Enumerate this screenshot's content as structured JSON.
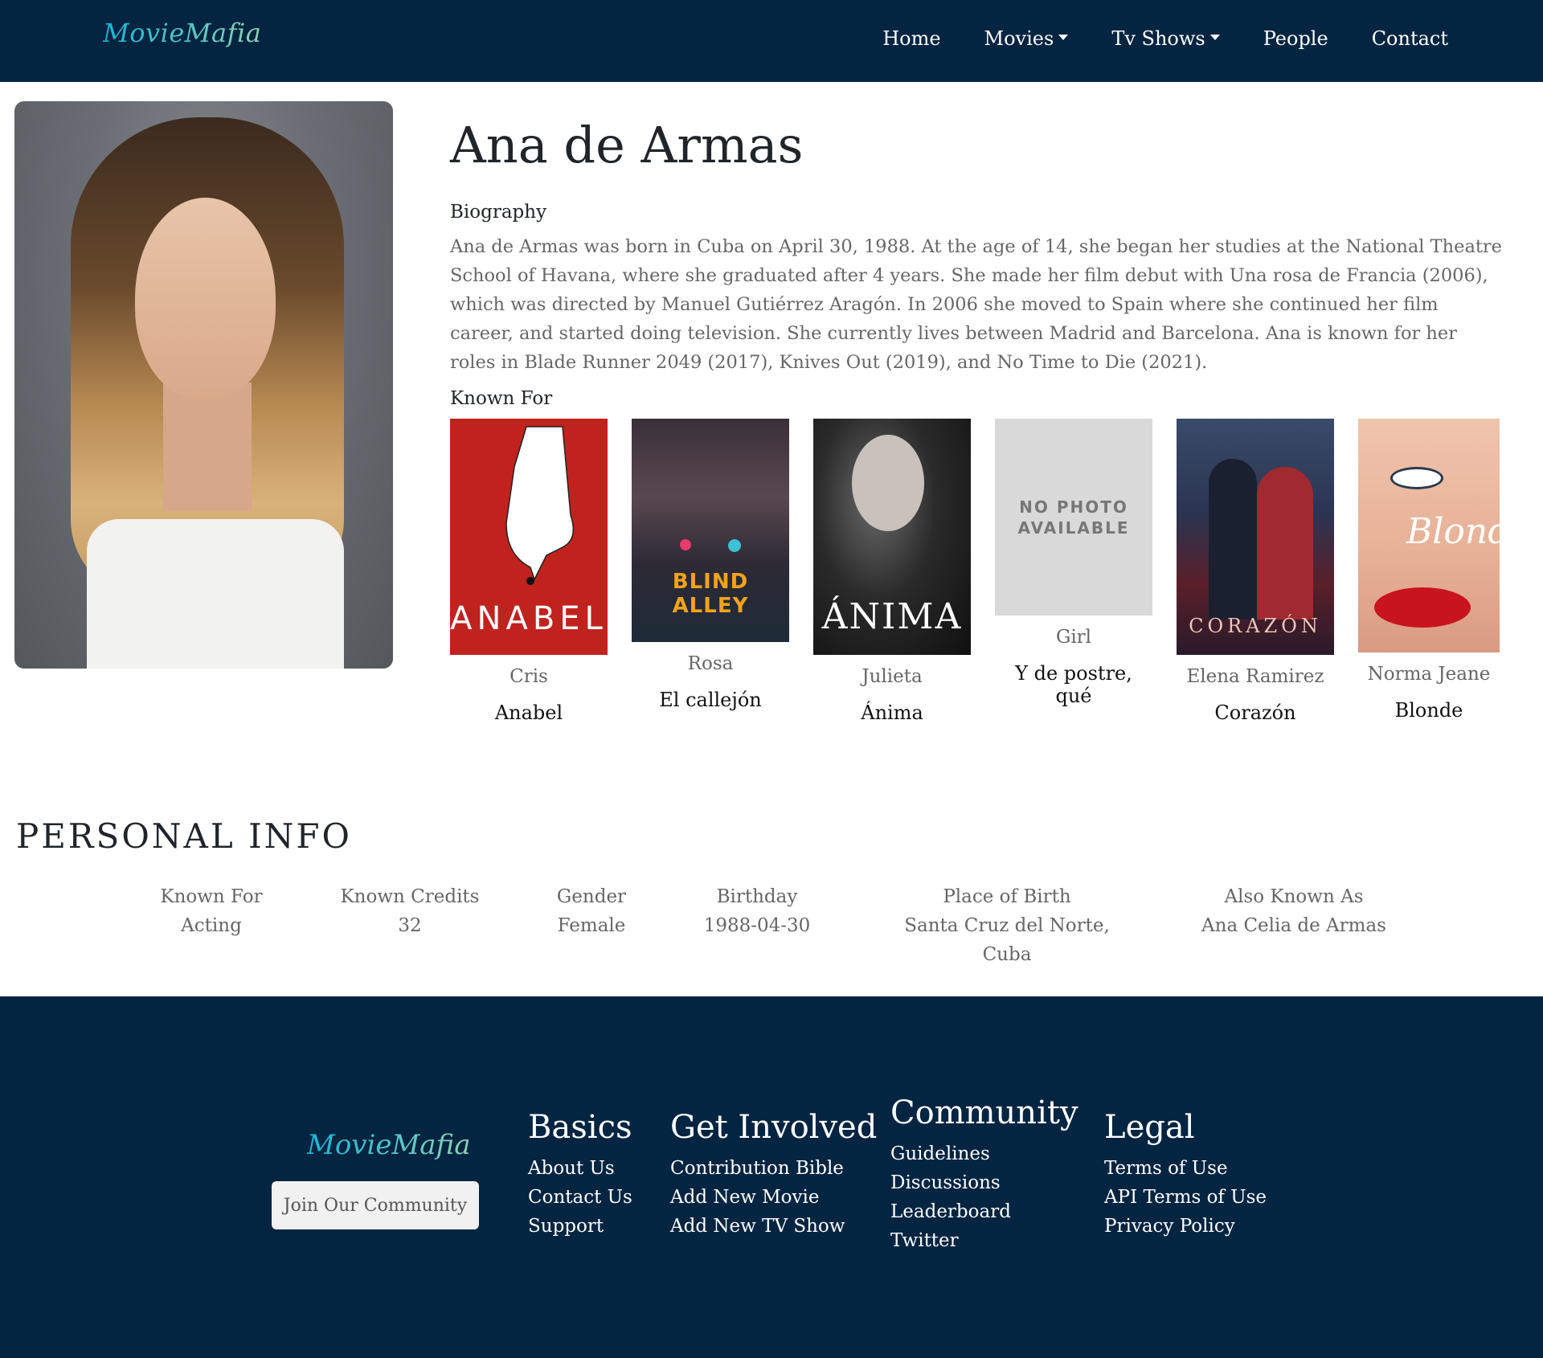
{
  "navbar": {
    "brand": "MovieMafia",
    "items": [
      {
        "label": "Home",
        "dropdown": false
      },
      {
        "label": "Movies",
        "dropdown": true
      },
      {
        "label": "Tv Shows",
        "dropdown": true
      },
      {
        "label": "People",
        "dropdown": false
      },
      {
        "label": "Contact",
        "dropdown": false
      }
    ]
  },
  "person": {
    "name": "Ana de Armas",
    "biography_heading": "Biography",
    "biography": "Ana de Armas was born in Cuba on April 30, 1988. At the age of 14, she began her studies at the National Theatre School of Havana, where she graduated after 4 years. She made her film debut with Una rosa de Francia (2006), which was directed by Manuel Gutiérrez Aragón. In 2006 she moved to Spain where she continued her film career, and started doing television. She currently lives between Madrid and Barcelona. Ana is known for her roles in Blade Runner 2049 (2017), Knives Out (2019), and No Time to Die (2021).",
    "known_for_heading": "Known For"
  },
  "credits": [
    {
      "character": "Cris",
      "title": "Anabel",
      "poster_text": "ANABEL",
      "poster_bg": "#c0231d"
    },
    {
      "character": "Rosa",
      "title": "El callejón",
      "poster_text": "BLIND ALLEY",
      "poster_bg": "#2b2430"
    },
    {
      "character": "Julieta",
      "title": "Ánima",
      "poster_text": "ÁNIMA",
      "poster_bg": "#1a1a1a"
    },
    {
      "character": "Girl",
      "title": "Y de postre, qué",
      "poster_text": "NO PHOTO AVAILABLE",
      "poster_bg": "#d9d9d9"
    },
    {
      "character": "Elena Ramirez",
      "title": "Corazón",
      "poster_text": "CORAZÓN",
      "poster_bg": "#2a3552"
    },
    {
      "character": "Norma Jeane",
      "title": "Blonde",
      "poster_text": "Blonde",
      "poster_bg": "#e8b79a"
    }
  ],
  "personal_info": {
    "heading": "PERSONAL INFO",
    "fields": [
      {
        "label": "Known For",
        "value": "Acting"
      },
      {
        "label": "Known Credits",
        "value": "32"
      },
      {
        "label": "Gender",
        "value": "Female"
      },
      {
        "label": "Birthday",
        "value": "1988-04-30"
      },
      {
        "label": "Place of Birth",
        "value": "Santa Cruz del Norte, Cuba"
      },
      {
        "label": "Also Known As",
        "value": "Ana Celia de Armas"
      }
    ]
  },
  "footer": {
    "brand": "MovieMafia",
    "join_button": "Join Our Community",
    "columns": [
      {
        "heading": "Basics",
        "links": [
          "About Us",
          "Contact Us",
          "Support"
        ]
      },
      {
        "heading": "Get Involved",
        "links": [
          "Contribution Bible",
          "Add New Movie",
          "Add New TV Show"
        ]
      },
      {
        "heading": "Community",
        "links": [
          "Guidelines",
          "Discussions",
          "Leaderboard",
          "Twitter"
        ]
      },
      {
        "heading": "Legal",
        "links": [
          "Terms of Use",
          "API Terms of Use",
          "Privacy Policy"
        ]
      }
    ]
  },
  "colors": {
    "navy": "#032541",
    "brand_gradient_start": "#1ab3d6",
    "brand_gradient_end": "#8fd3b5"
  }
}
